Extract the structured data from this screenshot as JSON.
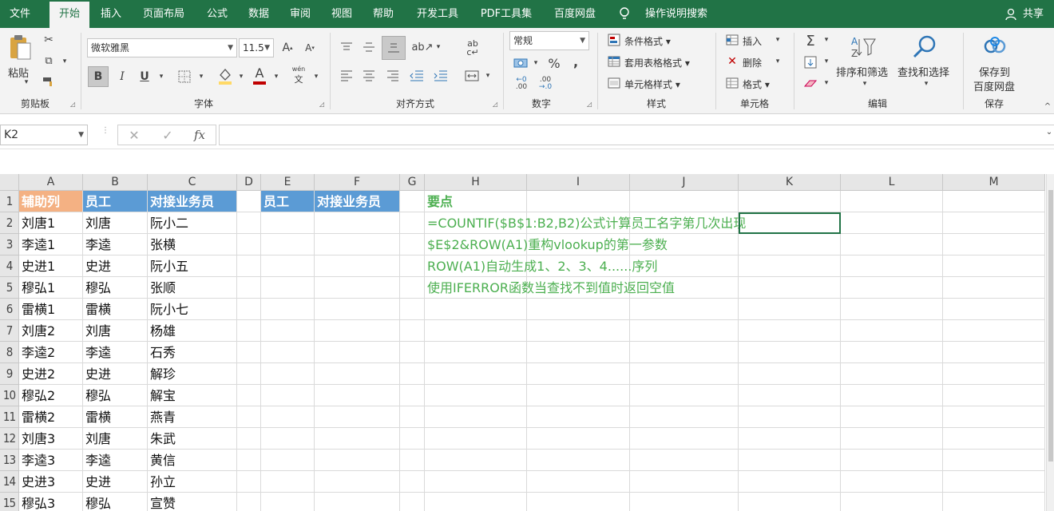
{
  "tabs": [
    "文件",
    "开始",
    "插入",
    "页面布局",
    "公式",
    "数据",
    "审阅",
    "视图",
    "帮助",
    "开发工具",
    "PDF工具集",
    "百度网盘"
  ],
  "tell_me": "操作说明搜索",
  "share": "共享",
  "ribbon": {
    "paste": "粘贴",
    "clipboard_group": "剪贴板",
    "font_name": "微软雅黑",
    "font_size": "11.5",
    "font_group": "字体",
    "bold": "B",
    "italic": "I",
    "underline": "U",
    "font_color_letter": "A",
    "phonetic": "文",
    "align_group": "对齐方式",
    "number_format": "常规",
    "number_group": "数字",
    "percent": "%",
    "comma": ",",
    "cond_format": "条件格式",
    "table_format": "套用表格格式",
    "cell_style": "单元格样式",
    "styles_group": "样式",
    "insert": "插入",
    "delete": "删除",
    "format": "格式",
    "cells_group": "单元格",
    "sum_symbol": "Σ",
    "sort_filter": "排序和筛选",
    "find_select": "查找和选择",
    "editing_group": "编辑",
    "save_baidu_1": "保存到",
    "save_baidu_2": "百度网盘",
    "save_group": "保存"
  },
  "formula_bar": {
    "name_box": "K2",
    "fx": "fx",
    "formula": ""
  },
  "columns": [
    "A",
    "B",
    "C",
    "D",
    "E",
    "F",
    "G",
    "H",
    "I",
    "J",
    "K",
    "L",
    "M"
  ],
  "rows": [
    "1",
    "2",
    "3",
    "4",
    "5",
    "6",
    "7",
    "8",
    "9",
    "10",
    "11",
    "12",
    "13",
    "14",
    "15"
  ],
  "header": {
    "a1": "辅助列",
    "b1": "员工",
    "c1": "对接业务员",
    "e1": "员工",
    "f1": "对接业务员",
    "h1": "要点"
  },
  "data_rows": [
    {
      "a": "刘唐1",
      "b": "刘唐",
      "c": "阮小二"
    },
    {
      "a": "李逵1",
      "b": "李逵",
      "c": "张横"
    },
    {
      "a": "史进1",
      "b": "史进",
      "c": "阮小五"
    },
    {
      "a": "穆弘1",
      "b": "穆弘",
      "c": "张顺"
    },
    {
      "a": "雷横1",
      "b": "雷横",
      "c": "阮小七"
    },
    {
      "a": "刘唐2",
      "b": "刘唐",
      "c": "杨雄"
    },
    {
      "a": "李逵2",
      "b": "李逵",
      "c": "石秀"
    },
    {
      "a": "史进2",
      "b": "史进",
      "c": "解珍"
    },
    {
      "a": "穆弘2",
      "b": "穆弘",
      "c": "解宝"
    },
    {
      "a": "雷横2",
      "b": "雷横",
      "c": "燕青"
    },
    {
      "a": "刘唐3",
      "b": "刘唐",
      "c": "朱武"
    },
    {
      "a": "李逵3",
      "b": "李逵",
      "c": "黄信"
    },
    {
      "a": "史进3",
      "b": "史进",
      "c": "孙立"
    },
    {
      "a": "穆弘3",
      "b": "穆弘",
      "c": "宣赞"
    }
  ],
  "notes": [
    "=COUNTIF($B$1:B2,B2)公式计算员工名字第几次出现",
    "$E$2&ROW(A1)重构vlookup的第一参数",
    "ROW(A1)自动生成1、2、3、4......序列",
    "使用IFERROR函数当查找不到值时返回空值"
  ],
  "colors": {
    "excel_green": "#217346",
    "header_orange": "#f4b183",
    "header_blue": "#5b9bd5",
    "note_green": "#4caf50"
  }
}
